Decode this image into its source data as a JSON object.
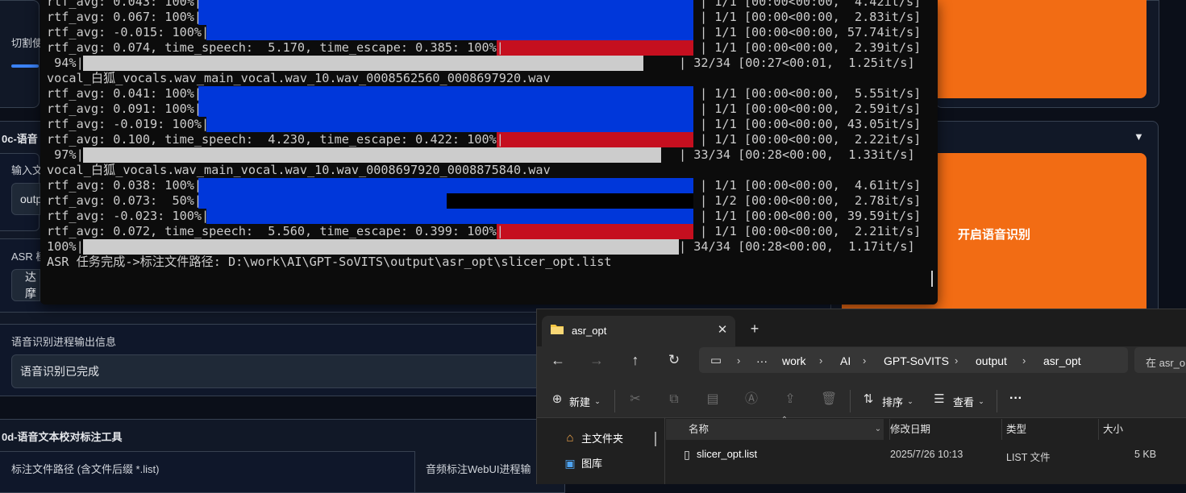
{
  "webui": {
    "slice_label": "切割使",
    "section_0c": "0c-语音",
    "input_label": "输入文",
    "input_value": "outp",
    "asr_model_label": "ASR 模",
    "asr_model_value": "达摩",
    "start_asr_button": "开启语音识别",
    "progress_label": "语音识别进程输出信息",
    "progress_value": "语音识别已完成",
    "section_0d": "0d-语音文本校对标注工具",
    "label_path_label": "标注文件路径 (含文件后缀 *.list)",
    "webui_progress_label": "音频标注WebUI进程输",
    "collapse_icon": "▼"
  },
  "terminal": {
    "lines": [
      "rtf_avg: 0.043: 100%|",
      "rtf_avg: 0.067: 100%|",
      "rtf_avg: -0.015: 100%|",
      "rtf_avg: 0.074, time_speech:  5.170, time_escape: 0.385: 100%|",
      " 94%|",
      "vocal_白狐_vocals.wav_main_vocal.wav_10.wav_0008562560_0008697920.wav",
      "rtf_avg: 0.041: 100%|",
      "rtf_avg: 0.091: 100%|",
      "rtf_avg: -0.019: 100%|",
      "rtf_avg: 0.100, time_speech:  4.230, time_escape: 0.422: 100%|",
      " 97%|",
      "vocal_白狐_vocals.wav_main_vocal.wav_10.wav_0008697920_0008875840.wav",
      "rtf_avg: 0.038: 100%|",
      "rtf_avg: 0.073:  50%|",
      "rtf_avg: -0.023: 100%|",
      "rtf_avg: 0.072, time_speech:  5.560, time_escape: 0.399: 100%|",
      "100%|",
      "ASR 任务完成->标注文件路径: D:\\work\\AI\\GPT-SoVITS\\output\\asr_opt\\slicer_opt.list"
    ],
    "tags": [
      "| 1/1 [00:00<00:00,  4.42it/s]",
      "| 1/1 [00:00<00:00,  2.83it/s]",
      "| 1/1 [00:00<00:00, 57.74it/s]",
      "| 1/1 [00:00<00:00,  2.39it/s]",
      "| 32/34 [00:27<00:01,  1.25it/s]",
      "",
      "| 1/1 [00:00<00:00,  5.55it/s]",
      "| 1/1 [00:00<00:00,  2.59it/s]",
      "| 1/1 [00:00<00:00, 43.05it/s]",
      "| 1/1 [00:00<00:00,  2.22it/s]",
      "| 33/34 [00:28<00:00,  1.33it/s]",
      "",
      "| 1/1 [00:00<00:00,  4.61it/s]",
      "| 1/2 [00:00<00:00,  2.78it/s]",
      "| 1/1 [00:00<00:00, 39.59it/s]",
      "| 1/1 [00:00<00:00,  2.21it/s]",
      "| 34/34 [00:28<00:00,  1.17it/s]",
      ""
    ],
    "colors": {
      "blue": "#0037da",
      "red": "#c50f1f",
      "gray": "#cccccc"
    }
  },
  "explorer": {
    "tab_title": "asr_opt",
    "folder_icon": "folder-icon",
    "breadcrumbs": [
      "work",
      "AI",
      "GPT-SoVITS",
      "output",
      "asr_opt"
    ],
    "search_placeholder": "在 asr_o",
    "new_label": "新建",
    "sort_label": "排序",
    "view_label": "查看",
    "more_label": "···",
    "nav_items": [
      "主文件夹",
      "图库"
    ],
    "columns": {
      "name": "名称",
      "date": "修改日期",
      "type": "类型",
      "size": "大小"
    },
    "files": [
      {
        "name": "slicer_opt.list",
        "date": "2025/7/26 10:13",
        "type": "LIST 文件",
        "size": "5 KB"
      }
    ]
  }
}
